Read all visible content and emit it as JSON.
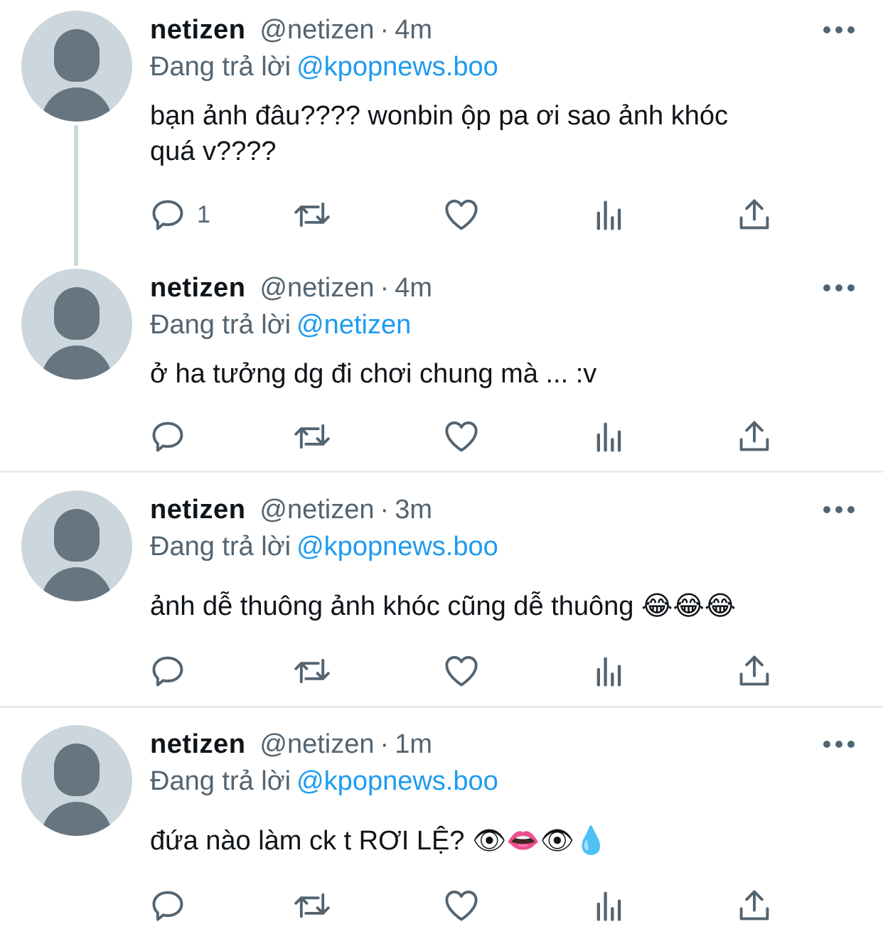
{
  "colors": {
    "accent": "#1d9bf0",
    "secondary_text": "#536471",
    "primary_text": "#0f1419",
    "avatar_bg": "#ccd6dd",
    "avatar_fg": "#66757f",
    "divider": "#e6ecf0"
  },
  "icons": {
    "reply": "reply-icon",
    "retweet": "retweet-icon",
    "like": "like-icon",
    "views": "views-icon",
    "share": "share-icon",
    "more": "more-icon"
  },
  "tweets": [
    {
      "name": "netizen",
      "handle": "@netizen",
      "separator": "·",
      "time": "4m",
      "reply_prefix": "Đang trả lời",
      "reply_to": "@kpopnews.boo",
      "text_line1": "bạn ảnh đâu???? wonbin ộp pa ơi sao ảnh khóc",
      "text_line2": "quá v????",
      "reply_count": "1"
    },
    {
      "name": "netizen",
      "handle": "@netizen",
      "separator": "·",
      "time": "4m",
      "reply_prefix": "Đang trả lời",
      "reply_to": "@netizen",
      "text_line1": "ở ha tưởng dg đi chơi chung mà ... :v",
      "reply_count": ""
    },
    {
      "name": "netizen",
      "handle": "@netizen",
      "separator": "·",
      "time": "3m",
      "reply_prefix": "Đang trả lời",
      "reply_to": "@kpopnews.boo",
      "text_line1": "ảnh dễ thuông ảnh khóc cũng dễ thuông 😂😂😂",
      "reply_count": ""
    },
    {
      "name": "netizen",
      "handle": "@netizen",
      "separator": "·",
      "time": "1m",
      "reply_prefix": "Đang trả lời",
      "reply_to": "@kpopnews.boo",
      "text_line1": "đứa nào làm ck t RƠI LỆ? 👁👄👁💧",
      "reply_count": ""
    }
  ]
}
